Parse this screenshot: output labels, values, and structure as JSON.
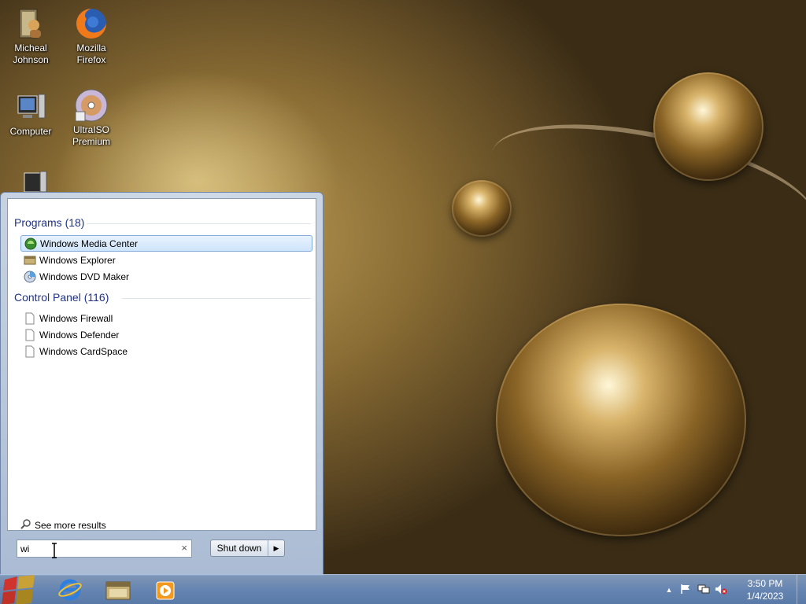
{
  "desktop": {
    "icons": [
      {
        "label_line1": "Micheal",
        "label_line2": "Johnson",
        "icon": "user-folder-icon"
      },
      {
        "label_line1": "Mozilla",
        "label_line2": "Firefox",
        "icon": "firefox-icon"
      },
      {
        "label_line1": "Computer",
        "label_line2": "",
        "icon": "computer-icon"
      },
      {
        "label_line1": "UltraISO",
        "label_line2": "Premium",
        "icon": "ultraiso-disc-icon"
      }
    ]
  },
  "start_menu": {
    "programs_header": "Programs (18)",
    "programs": [
      {
        "label": "Windows Media Center",
        "icon": "media-center-icon",
        "selected": true
      },
      {
        "label": "Windows Explorer",
        "icon": "explorer-icon",
        "selected": false
      },
      {
        "label": "Windows DVD Maker",
        "icon": "dvd-maker-icon",
        "selected": false
      }
    ],
    "control_panel_header": "Control Panel (116)",
    "control_panel": [
      {
        "label": "Windows Firewall",
        "icon": "document-icon"
      },
      {
        "label": "Windows Defender",
        "icon": "document-icon"
      },
      {
        "label": "Windows CardSpace",
        "icon": "document-icon"
      }
    ],
    "see_more": "See more results",
    "search_value": "wi",
    "search_clear": "×",
    "shutdown_label": "Shut down",
    "shutdown_arrow": "▶"
  },
  "taskbar": {
    "pinned": [
      "start-orb-icon",
      "internet-explorer-icon",
      "explorer-folder-icon",
      "media-player-icon"
    ],
    "tray": {
      "show_hidden": "▲",
      "icons": [
        "action-center-flag-icon",
        "network-icon",
        "volume-muted-icon"
      ]
    },
    "clock": {
      "time": "3:50 PM",
      "date": "1/4/2023"
    }
  },
  "colors": {
    "group_title": "#1e3287",
    "taskbar": "#6f8fbf",
    "selection": "#cfe4fb"
  }
}
